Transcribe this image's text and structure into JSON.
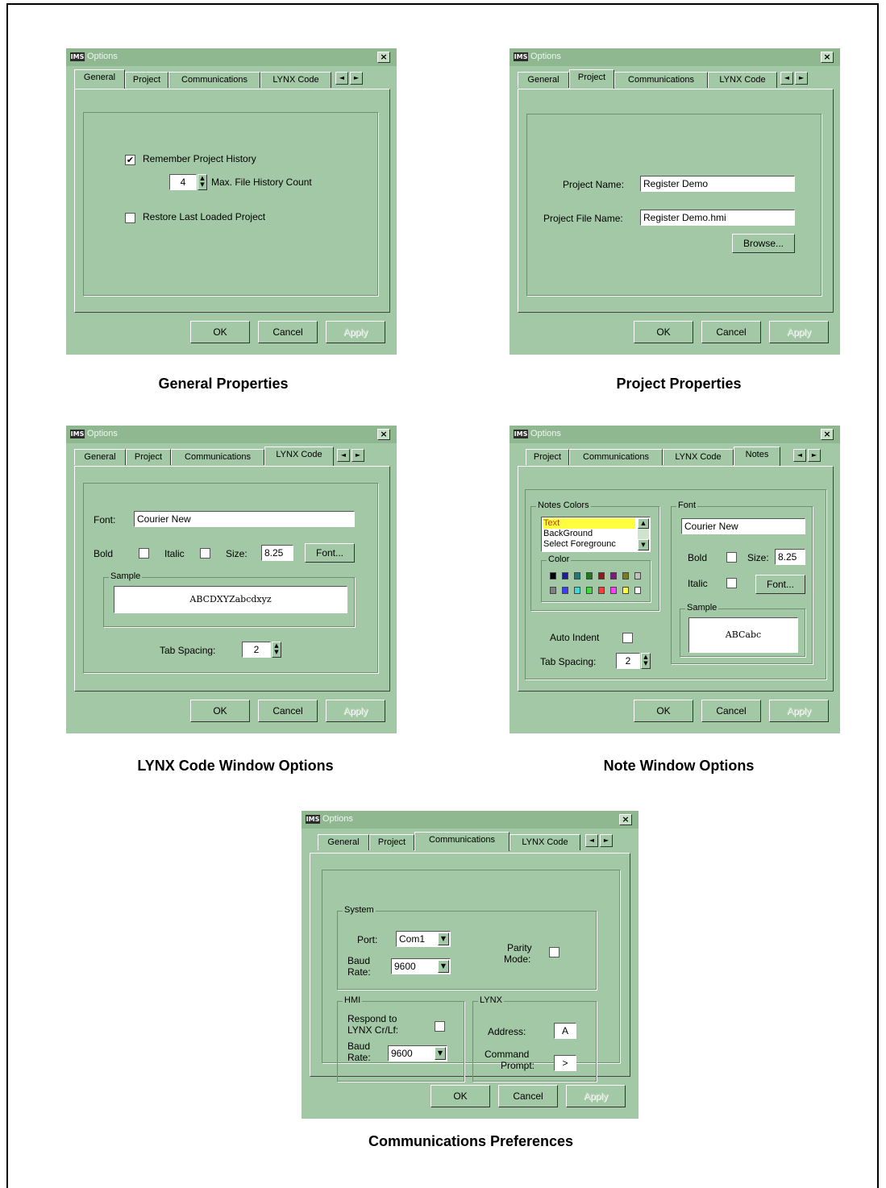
{
  "dialog_common": {
    "title": "Options",
    "app_icon": "IMS",
    "close_glyph": "×",
    "arrow_left": "◄",
    "arrow_right": "►",
    "ok": "OK",
    "cancel": "Cancel",
    "apply": "Apply",
    "spin_up": "▲",
    "spin_down": "▼",
    "dropdown": "▼",
    "check": "✔"
  },
  "tabs_a": [
    "General",
    "Project",
    "Communications",
    "LYNX Code"
  ],
  "tabs_b": [
    "Project",
    "Communications",
    "LYNX Code",
    "Notes"
  ],
  "general": {
    "remember_history": "Remember Project History",
    "history_count": "4",
    "max_history": "Max. File History Count",
    "restore_last": "Restore Last Loaded Project",
    "caption": "General Properties"
  },
  "project": {
    "name_label": "Project Name:",
    "name_value": "Register Demo",
    "file_label": "Project File Name:",
    "file_value": "Register Demo.hmi",
    "browse": "Browse...",
    "caption": "Project  Properties"
  },
  "lynx": {
    "font_label": "Font:",
    "font_value": "Courier New",
    "bold": "Bold",
    "italic": "Italic",
    "size_label": "Size:",
    "size_value": "8.25",
    "font_btn": "Font...",
    "sample_group": "Sample",
    "sample_text": "ABCDXYZabcdxyz",
    "tab_spacing": "Tab Spacing:",
    "tab_value": "2",
    "caption": "LYNX Code  Window Options"
  },
  "notes": {
    "colors_group": "Notes Colors",
    "color_items": [
      "Text",
      "BackGround",
      "Select Foregrounc"
    ],
    "color_group": "Color",
    "palette": [
      "#000000",
      "#1e1e9c",
      "#1b7c7c",
      "#1c7c1c",
      "#8c1c1c",
      "#7c1c7c",
      "#7c7c1c",
      "#c0c0c0",
      "#808080",
      "#3c3cff",
      "#3cdcdc",
      "#3cdc3c",
      "#ff3c3c",
      "#ff3cff",
      "#ffff3c",
      "#ffffff"
    ],
    "auto_indent": "Auto Indent",
    "tab_spacing": "Tab Spacing:",
    "tab_value": "2",
    "font_group": "Font",
    "font_value": "Courier New",
    "bold": "Bold",
    "size_label": "Size:",
    "size_value": "8.25",
    "italic": "Italic",
    "font_btn": "Font...",
    "sample_group": "Sample",
    "sample_text": "ABCabc",
    "caption": "Note Window Options"
  },
  "comms": {
    "system_group": "System",
    "port_label": "Port:",
    "port_value": "Com1",
    "baud_label_1": "Baud",
    "baud_label_2": "Rate:",
    "baud_value": "9600",
    "parity_1": "Parity",
    "parity_2": "Mode:",
    "hmi_group": "HMI",
    "respond_1": "Respond to",
    "respond_2": "LYNX Cr/Lf:",
    "hmi_baud_value": "9600",
    "lynx_group": "LYNX",
    "address_label": "Address:",
    "address_value": "A",
    "command_1": "Command",
    "command_2": "Prompt:",
    "prompt_value": ">",
    "caption": "Communications Preferences"
  }
}
